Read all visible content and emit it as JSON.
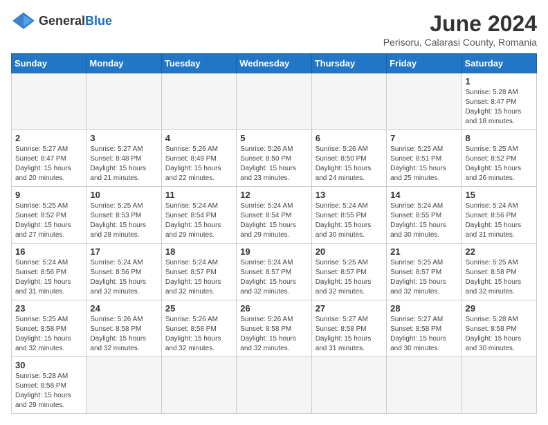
{
  "header": {
    "logo_general": "General",
    "logo_blue": "Blue",
    "title": "June 2024",
    "subtitle": "Perisoru, Calarasi County, Romania"
  },
  "days_of_week": [
    "Sunday",
    "Monday",
    "Tuesday",
    "Wednesday",
    "Thursday",
    "Friday",
    "Saturday"
  ],
  "weeks": [
    [
      {
        "day": "",
        "info": ""
      },
      {
        "day": "",
        "info": ""
      },
      {
        "day": "",
        "info": ""
      },
      {
        "day": "",
        "info": ""
      },
      {
        "day": "",
        "info": ""
      },
      {
        "day": "",
        "info": ""
      },
      {
        "day": "1",
        "info": "Sunrise: 5:28 AM\nSunset: 8:47 PM\nDaylight: 15 hours and 18 minutes."
      }
    ],
    [
      {
        "day": "2",
        "info": "Sunrise: 5:27 AM\nSunset: 8:47 PM\nDaylight: 15 hours and 20 minutes."
      },
      {
        "day": "3",
        "info": "Sunrise: 5:27 AM\nSunset: 8:48 PM\nDaylight: 15 hours and 21 minutes."
      },
      {
        "day": "4",
        "info": "Sunrise: 5:26 AM\nSunset: 8:49 PM\nDaylight: 15 hours and 22 minutes."
      },
      {
        "day": "5",
        "info": "Sunrise: 5:26 AM\nSunset: 8:50 PM\nDaylight: 15 hours and 23 minutes."
      },
      {
        "day": "6",
        "info": "Sunrise: 5:26 AM\nSunset: 8:50 PM\nDaylight: 15 hours and 24 minutes."
      },
      {
        "day": "7",
        "info": "Sunrise: 5:25 AM\nSunset: 8:51 PM\nDaylight: 15 hours and 25 minutes."
      },
      {
        "day": "8",
        "info": "Sunrise: 5:25 AM\nSunset: 8:52 PM\nDaylight: 15 hours and 26 minutes."
      }
    ],
    [
      {
        "day": "9",
        "info": "Sunrise: 5:25 AM\nSunset: 8:52 PM\nDaylight: 15 hours and 27 minutes."
      },
      {
        "day": "10",
        "info": "Sunrise: 5:25 AM\nSunset: 8:53 PM\nDaylight: 15 hours and 28 minutes."
      },
      {
        "day": "11",
        "info": "Sunrise: 5:24 AM\nSunset: 8:54 PM\nDaylight: 15 hours and 29 minutes."
      },
      {
        "day": "12",
        "info": "Sunrise: 5:24 AM\nSunset: 8:54 PM\nDaylight: 15 hours and 29 minutes."
      },
      {
        "day": "13",
        "info": "Sunrise: 5:24 AM\nSunset: 8:55 PM\nDaylight: 15 hours and 30 minutes."
      },
      {
        "day": "14",
        "info": "Sunrise: 5:24 AM\nSunset: 8:55 PM\nDaylight: 15 hours and 30 minutes."
      },
      {
        "day": "15",
        "info": "Sunrise: 5:24 AM\nSunset: 8:56 PM\nDaylight: 15 hours and 31 minutes."
      }
    ],
    [
      {
        "day": "16",
        "info": "Sunrise: 5:24 AM\nSunset: 8:56 PM\nDaylight: 15 hours and 31 minutes."
      },
      {
        "day": "17",
        "info": "Sunrise: 5:24 AM\nSunset: 8:56 PM\nDaylight: 15 hours and 32 minutes."
      },
      {
        "day": "18",
        "info": "Sunrise: 5:24 AM\nSunset: 8:57 PM\nDaylight: 15 hours and 32 minutes."
      },
      {
        "day": "19",
        "info": "Sunrise: 5:24 AM\nSunset: 8:57 PM\nDaylight: 15 hours and 32 minutes."
      },
      {
        "day": "20",
        "info": "Sunrise: 5:25 AM\nSunset: 8:57 PM\nDaylight: 15 hours and 32 minutes."
      },
      {
        "day": "21",
        "info": "Sunrise: 5:25 AM\nSunset: 8:57 PM\nDaylight: 15 hours and 32 minutes."
      },
      {
        "day": "22",
        "info": "Sunrise: 5:25 AM\nSunset: 8:58 PM\nDaylight: 15 hours and 32 minutes."
      }
    ],
    [
      {
        "day": "23",
        "info": "Sunrise: 5:25 AM\nSunset: 8:58 PM\nDaylight: 15 hours and 32 minutes."
      },
      {
        "day": "24",
        "info": "Sunrise: 5:26 AM\nSunset: 8:58 PM\nDaylight: 15 hours and 32 minutes."
      },
      {
        "day": "25",
        "info": "Sunrise: 5:26 AM\nSunset: 8:58 PM\nDaylight: 15 hours and 32 minutes."
      },
      {
        "day": "26",
        "info": "Sunrise: 5:26 AM\nSunset: 8:58 PM\nDaylight: 15 hours and 32 minutes."
      },
      {
        "day": "27",
        "info": "Sunrise: 5:27 AM\nSunset: 8:58 PM\nDaylight: 15 hours and 31 minutes."
      },
      {
        "day": "28",
        "info": "Sunrise: 5:27 AM\nSunset: 8:58 PM\nDaylight: 15 hours and 30 minutes."
      },
      {
        "day": "29",
        "info": "Sunrise: 5:28 AM\nSunset: 8:58 PM\nDaylight: 15 hours and 30 minutes."
      }
    ],
    [
      {
        "day": "30",
        "info": "Sunrise: 5:28 AM\nSunset: 8:58 PM\nDaylight: 15 hours and 29 minutes."
      },
      {
        "day": "",
        "info": ""
      },
      {
        "day": "",
        "info": ""
      },
      {
        "day": "",
        "info": ""
      },
      {
        "day": "",
        "info": ""
      },
      {
        "day": "",
        "info": ""
      },
      {
        "day": "",
        "info": ""
      }
    ]
  ]
}
